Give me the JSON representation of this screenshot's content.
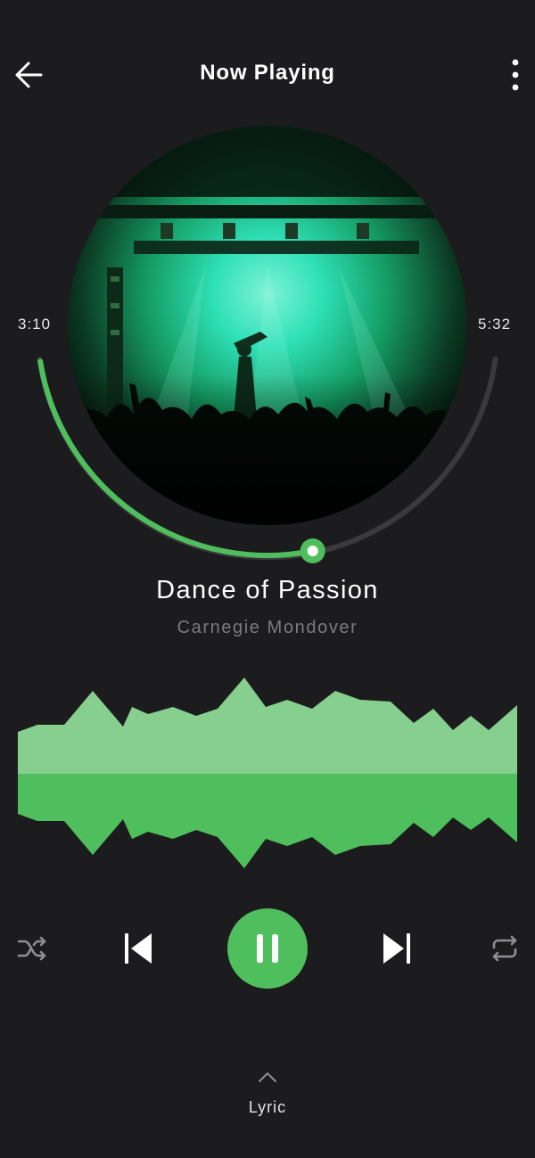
{
  "header": {
    "title": "Now Playing",
    "back_icon": "arrow-left-icon",
    "menu_icon": "more-vertical-icon"
  },
  "player": {
    "elapsed": "3:10",
    "total": "5:32",
    "progress_fraction": 0.57,
    "artwork_description_icon": "album-art",
    "track_title": "Dance of Passion",
    "artist": "Carnegie Mondover"
  },
  "controls": {
    "shuffle_icon": "shuffle-icon",
    "previous_icon": "skip-previous-icon",
    "play_pause_icon": "pause-icon",
    "next_icon": "skip-next-icon",
    "repeat_icon": "repeat-icon"
  },
  "lyric": {
    "label": "Lyric",
    "icon": "chevron-up-icon"
  },
  "colors": {
    "background": "#1c1c1e",
    "accent": "#4fbf5d",
    "accent_light": "#86cf8e",
    "track_inactive": "#3a3a3c",
    "artist_text": "#7b7b7f"
  }
}
